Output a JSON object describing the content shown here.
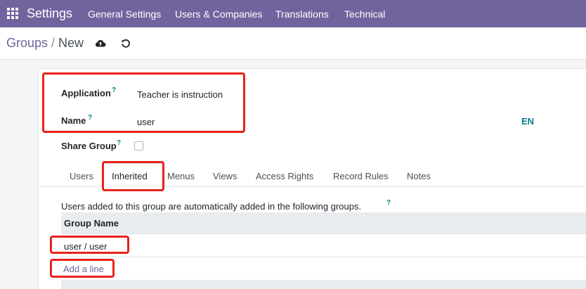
{
  "navbar": {
    "app_title": "Settings",
    "menu": [
      "General Settings",
      "Users & Companies",
      "Translations",
      "Technical"
    ]
  },
  "control": {
    "breadcrumb_parent": "Groups",
    "breadcrumb_separator": "/",
    "breadcrumb_current": "New",
    "save_icon": "cloud-upload-icon",
    "discard_icon": "undo-icon"
  },
  "form": {
    "application_label": "Application",
    "application_value": "Teacher is instruction",
    "name_label": "Name",
    "name_value": "user",
    "share_group_label": "Share Group",
    "share_group_checked": false,
    "help_mark": "?",
    "lang_button": "EN"
  },
  "tabs": [
    "Users",
    "Inherited",
    "Menus",
    "Views",
    "Access Rights",
    "Record Rules",
    "Notes"
  ],
  "active_tab": "Inherited",
  "inherited": {
    "description": "Users added to this group are automatically added in the following groups.",
    "column_header": "Group Name",
    "rows": [
      "user / user"
    ],
    "add_line": "Add a line"
  },
  "colors": {
    "brand": "#71639e",
    "help": "#017e84",
    "annotation": "#e8221b"
  }
}
